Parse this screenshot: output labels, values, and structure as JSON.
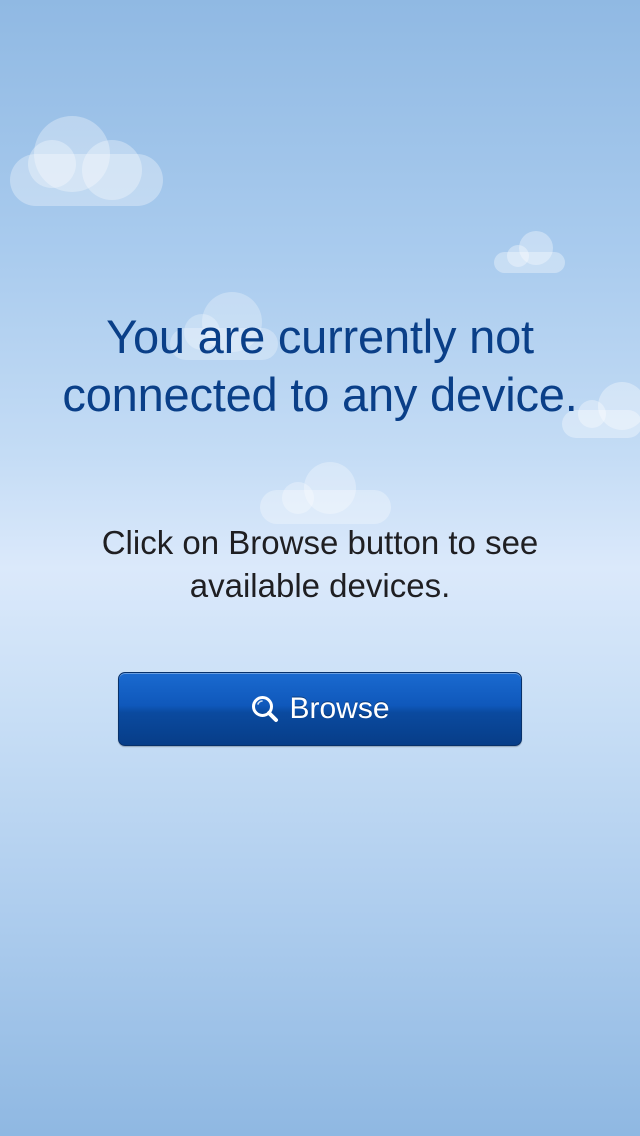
{
  "message": {
    "headline": "You are currently not connected to any device.",
    "instruction": "Click on Browse button to see available devices."
  },
  "browse_button": {
    "label": "Browse",
    "icon": "search-icon"
  },
  "colors": {
    "headline": "#0a3f88",
    "instruction": "#1f1f22",
    "button": "#0f58bb",
    "button_text": "#ffffff"
  }
}
